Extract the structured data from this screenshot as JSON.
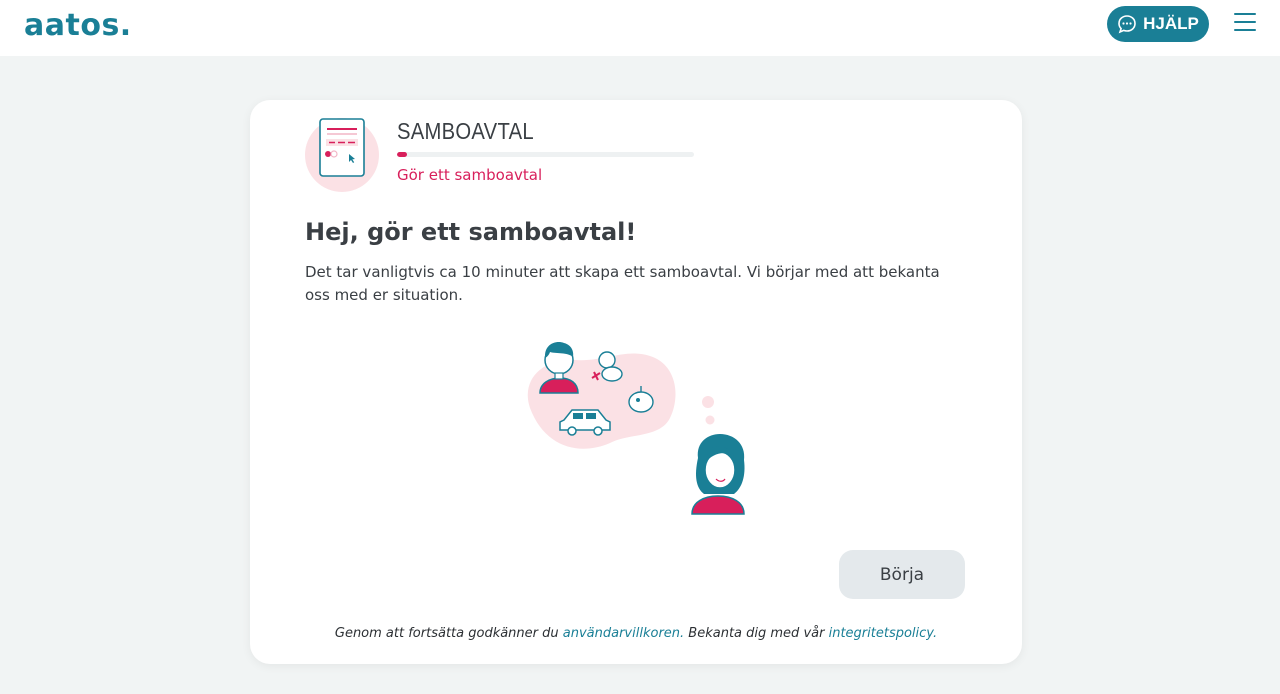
{
  "header": {
    "logo": "aatos.",
    "help_label": "HJÄLP",
    "help_icon": "chat-bubble-icon",
    "menu_icon": "hamburger-menu-icon"
  },
  "card": {
    "section_title": "SAMBOAVTAL",
    "progress_percent": 3.5,
    "step_label": "Gör ett samboavtal",
    "heading": "Hej, gör ett samboavtal!",
    "intro": "Det tar vanligtvis ca 10 minuter att skapa ett samboavtal. Vi börjar med att bekanta oss med er situation.",
    "start_button": "Börja",
    "terms": {
      "prefix": "Genom att fortsätta godkänner du ",
      "terms_link": "användarvillkoren.",
      "middle": " Bekanta dig med vår ",
      "privacy_link": "integritetspolicy."
    }
  },
  "colors": {
    "brand": "#1a7f96",
    "accent": "#d81f5b",
    "background": "#f1f4f4"
  }
}
